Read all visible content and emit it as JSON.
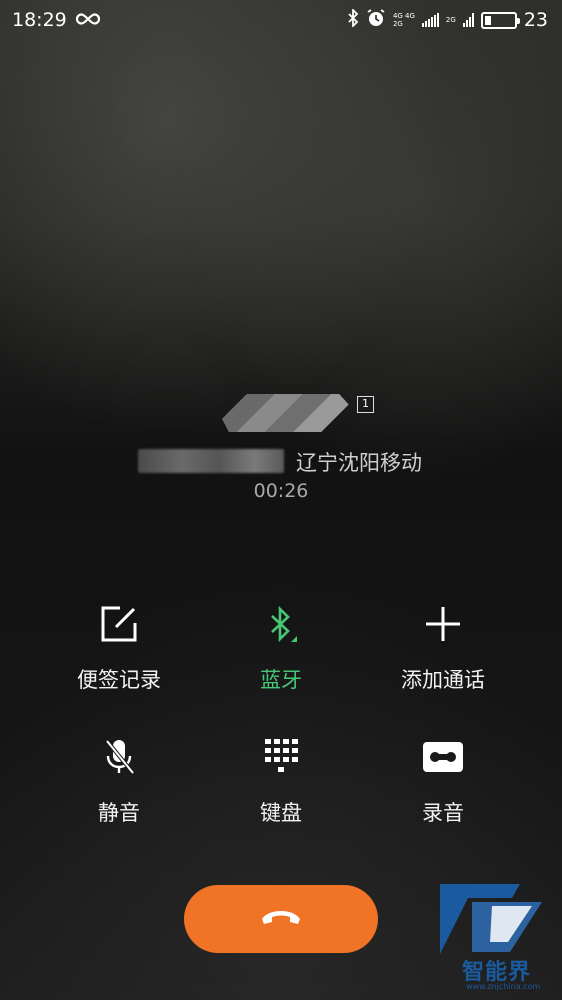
{
  "status_bar": {
    "time": "18:29",
    "net_top": "4G 4G",
    "net_bottom": "2G",
    "net_right": "2G",
    "battery_level": "23",
    "battery_fraction": 0.23,
    "icons": [
      "infinity-icon",
      "bluetooth-icon",
      "alarm-icon",
      "signal-icon",
      "battery-icon"
    ]
  },
  "call": {
    "sim_slot": "1",
    "location": "辽宁沈阳移动",
    "timer": "00:26"
  },
  "actions": [
    {
      "label": "便签记录",
      "icon": "note-icon",
      "active": false
    },
    {
      "label": "蓝牙",
      "icon": "bluetooth-icon",
      "active": true
    },
    {
      "label": "添加通话",
      "icon": "plus-icon",
      "active": false
    },
    {
      "label": "静音",
      "icon": "mute-icon",
      "active": false
    },
    {
      "label": "键盘",
      "icon": "keypad-icon",
      "active": false
    },
    {
      "label": "录音",
      "icon": "record-icon",
      "active": false
    }
  ],
  "end_call": {
    "icon": "hang-up-icon"
  },
  "watermark": {
    "text": "智能界",
    "url": "www.znjchina.com"
  },
  "colors": {
    "accent_green": "#46c776",
    "end_call_orange": "#f07326"
  }
}
